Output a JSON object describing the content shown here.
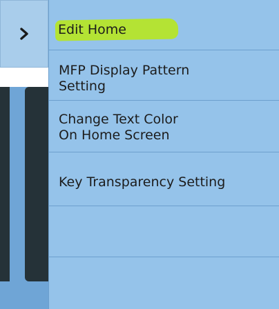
{
  "toggle": {
    "icon": "chevron-right-icon"
  },
  "menu": {
    "items": [
      {
        "label": "Edit Home",
        "highlighted": true
      },
      {
        "label_line1": "MFP Display Pattern",
        "label_line2": "Setting"
      },
      {
        "label_line1": "Change Text Color",
        "label_line2": "On Home Screen"
      },
      {
        "label": "Key Transparency Setting"
      },
      {
        "label": ""
      },
      {
        "label": ""
      }
    ]
  },
  "colors": {
    "panel_bg": "#95c3ea",
    "divider": "#6c9fcd",
    "toggle_bg": "#a9cdeb",
    "highlight": "#b5e52a",
    "dark_bg": "#253238",
    "text": "#1c1c1c"
  }
}
